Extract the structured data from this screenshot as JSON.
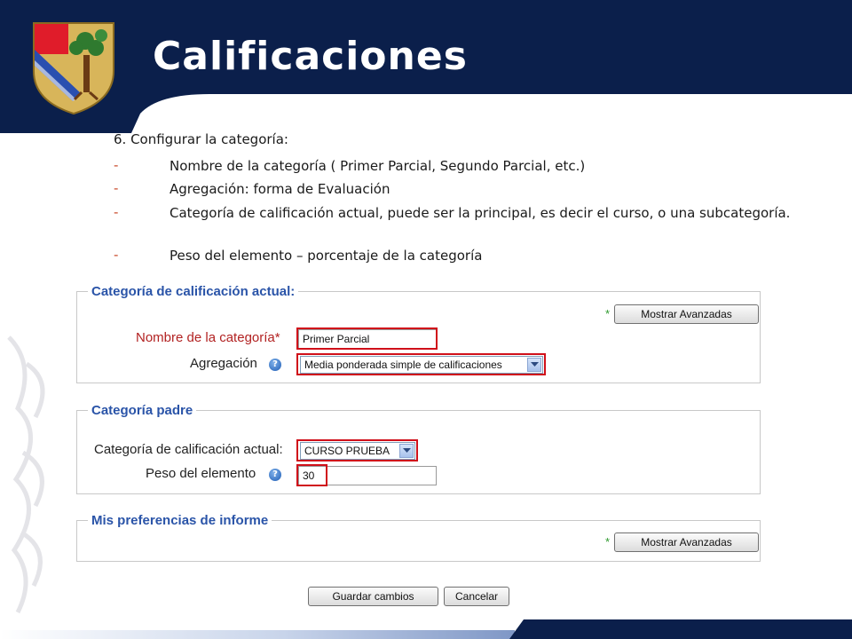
{
  "slide": {
    "title": "Calificaciones"
  },
  "colors": {
    "navy": "#0b1f4b",
    "accent_red": "#d0101a",
    "legend_blue": "#2a54a8",
    "required_red": "#b22222"
  },
  "icons": {
    "logo": "coat-of-arms-icon",
    "help": "help-icon",
    "dropdown": "chevron-down-icon"
  },
  "instructions": {
    "heading": "6. Configurar la categoría:",
    "bullet_marker": "-",
    "items": [
      "Nombre de la categoría ( Primer Parcial, Segundo Parcial, etc.)",
      "Agregación: forma de Evaluación",
      "Categoría de calificación actual, puede ser la principal, es decir el curso, o una subcategoría.",
      "Peso del elemento – porcentaje de la categoría"
    ]
  },
  "form": {
    "section1": {
      "legend": "Categoría de calificación actual:",
      "required_marker": "*",
      "advanced_button": "Mostrar Avanzadas",
      "name_label": "Nombre de la categoría",
      "name_value": "Primer Parcial",
      "aggregation_label": "Agregación",
      "aggregation_value": "Media ponderada simple de calificaciones"
    },
    "section2": {
      "legend": "Categoría padre",
      "parent_label": "Categoría de calificación actual:",
      "parent_value": "CURSO PRUEBA",
      "weight_label": "Peso del elemento",
      "weight_value": "30"
    },
    "section3": {
      "legend": "Mis preferencias de informe",
      "required_marker": "*",
      "advanced_button": "Mostrar Avanzadas"
    },
    "buttons": {
      "save": "Guardar cambios",
      "cancel": "Cancelar"
    }
  }
}
